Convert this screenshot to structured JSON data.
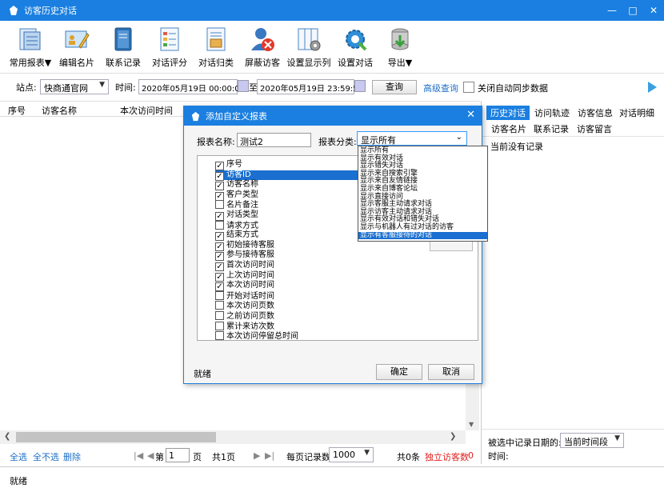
{
  "window": {
    "title": "访客历史对话",
    "minimize": "—",
    "maximize": "□",
    "close": "✕"
  },
  "toolbar": [
    {
      "label": "常用报表▼",
      "icon": "report-icon"
    },
    {
      "label": "编辑名片",
      "icon": "edit-card-icon"
    },
    {
      "label": "联系记录",
      "icon": "contact-log-icon"
    },
    {
      "label": "对话评分",
      "icon": "rating-icon"
    },
    {
      "label": "对话归类",
      "icon": "classify-icon"
    },
    {
      "label": "屏蔽访客",
      "icon": "block-user-icon"
    },
    {
      "label": "设置显示列",
      "icon": "columns-icon"
    },
    {
      "label": "设置对话",
      "icon": "settings-gear-icon"
    },
    {
      "label": "导出▼",
      "icon": "export-icon"
    }
  ],
  "filter": {
    "site_label": "站点:",
    "site_value": "快商通官网",
    "time_label": "时间:",
    "start": "2020年05月19日 00:00:00",
    "to": "至",
    "end": "2020年05月19日 23:59:59",
    "query": "查询",
    "advanced": "高级查询",
    "autosync": "关闭自动同步数据"
  },
  "grid": {
    "headers": [
      "序号",
      "访客名称",
      "本次访问时间"
    ]
  },
  "right_panel": {
    "tabs_row1": [
      "历史对话",
      "访问轨迹",
      "访客信息",
      "对话明细"
    ],
    "tabs_row2": [
      "访客名片",
      "联系记录",
      "访客留言"
    ],
    "empty": "当前没有记录",
    "date_label": "被选中记录日期的:",
    "date_value": "当前时间段",
    "time_label": "时间:"
  },
  "pager": {
    "select_all": "全选",
    "select_none": "全不选",
    "delete": "删除",
    "page_prefix": "第",
    "page_value": "1",
    "page_suffix": "页",
    "total_pages": "共1页",
    "per_page_label": "每页记录数",
    "per_page_value": "1000",
    "total": "共0条",
    "independent_label": "独立访客数",
    "independent_value": "0"
  },
  "status": "就绪",
  "dialog": {
    "title": "添加自定义报表",
    "name_label": "报表名称:",
    "name_value": "测试2",
    "category_label": "报表分类:",
    "category_value": "显示所有",
    "status": "就绪",
    "ok": "确定",
    "cancel": "取消",
    "fields": [
      {
        "label": "序号",
        "checked": true
      },
      {
        "label": "访客ID",
        "checked": true,
        "selected": true
      },
      {
        "label": "访客名称",
        "checked": true
      },
      {
        "label": "客户类型",
        "checked": true
      },
      {
        "label": "名片备注",
        "checked": false
      },
      {
        "label": "对话类型",
        "checked": true
      },
      {
        "label": "请求方式",
        "checked": false
      },
      {
        "label": "结束方式",
        "checked": true
      },
      {
        "label": "初始接待客服",
        "checked": true
      },
      {
        "label": "参与接待客服",
        "checked": true
      },
      {
        "label": "首次访问时间",
        "checked": true
      },
      {
        "label": "上次访问时间",
        "checked": true
      },
      {
        "label": "本次访问时间",
        "checked": true
      },
      {
        "label": "开始对话时间",
        "checked": false
      },
      {
        "label": "本次访问页数",
        "checked": false
      },
      {
        "label": "之前访问页数",
        "checked": false
      },
      {
        "label": "累计来访次数",
        "checked": false
      },
      {
        "label": "本次访问停留总时间",
        "checked": false
      }
    ],
    "category_options": [
      "显示所有",
      "显示有效对话",
      "显示错失对话",
      "显示来自搜索引擎",
      "显示来自友情链接",
      "显示来自博客论坛",
      "显示直接访问",
      "显示客服主动请求对话",
      "显示访客主动请求对话",
      "显示有效对话和错失对话",
      "显示与机器人有过对话的访客",
      "显示有客服接待的对话"
    ]
  }
}
